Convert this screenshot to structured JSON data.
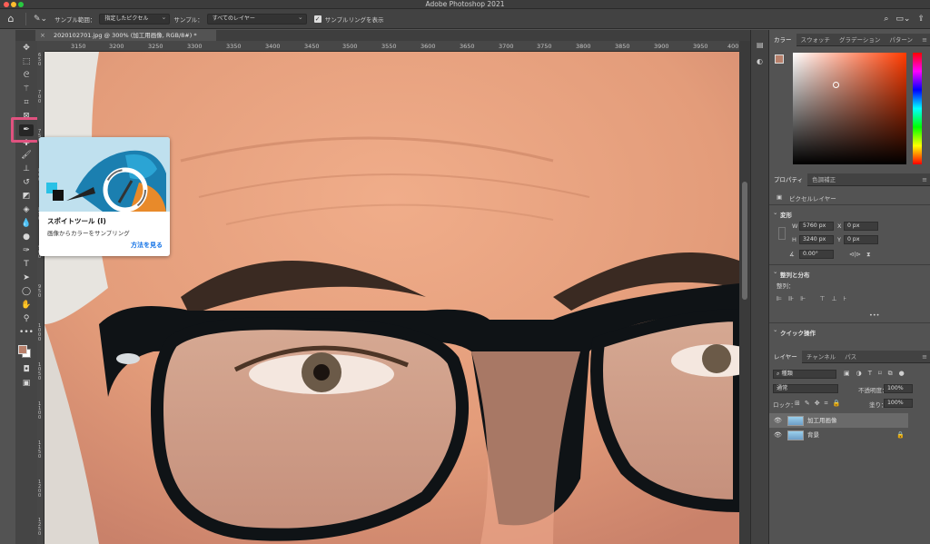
{
  "app": {
    "title": "Adobe Photoshop 2021"
  },
  "options_bar": {
    "sample_size_label": "サンプル範囲：",
    "sample_size_value": "指定したピクセル",
    "sample_label": "サンプル：",
    "sample_value": "すべてのレイヤー",
    "sampling_ring_label": "サンプルリングを表示",
    "sampling_ring_checked": true
  },
  "document_tab": {
    "title": "2020102701.jpg @ 300% (加工用画像, RGB/8#) *"
  },
  "ruler": {
    "top": [
      "3150",
      "3200",
      "3250",
      "3300",
      "3350",
      "3400",
      "3450",
      "3500",
      "3550",
      "3600",
      "3650",
      "3700",
      "3750",
      "3800",
      "3850",
      "3900",
      "3950",
      "400"
    ],
    "left": [
      "650",
      "700",
      "750",
      "800",
      "850",
      "900",
      "950",
      "1000",
      "1050",
      "1100",
      "1150",
      "1200",
      "1250"
    ]
  },
  "tooltip": {
    "title": "スポイトツール (I)",
    "description": "画像からカラーをサンプリング",
    "link": "方法を見る"
  },
  "color_panel": {
    "tabs": [
      "カラー",
      "スウォッチ",
      "グラデーション",
      "パターン"
    ],
    "foreground": "#b8806b",
    "background": "#ffffff"
  },
  "properties_panel": {
    "tabs": [
      "プロパティ",
      "色調補正"
    ],
    "layer_kind": "ピクセルレイヤー",
    "transform_header": "変形",
    "w_label": "W",
    "w_value": "5760 px",
    "x_label": "X",
    "x_value": "0 px",
    "h_label": "H",
    "h_value": "3240 px",
    "y_label": "Y",
    "y_value": "0 px",
    "angle_value": "0.00°",
    "align_header": "整列と分布",
    "align_label": "整列：",
    "more": "•••",
    "quick_header": "クイック操作"
  },
  "layers_panel": {
    "tabs": [
      "レイヤー",
      "チャンネル",
      "パス"
    ],
    "filter_kind": "種類",
    "blend_mode": "通常",
    "opacity_label": "不透明度：",
    "opacity_value": "100%",
    "lock_label": "ロック：",
    "fill_label": "塗り：",
    "fill_value": "100%",
    "layers": [
      {
        "name": "加工用画像",
        "selected": true,
        "locked": false
      },
      {
        "name": "背景",
        "selected": false,
        "locked": true
      }
    ]
  }
}
